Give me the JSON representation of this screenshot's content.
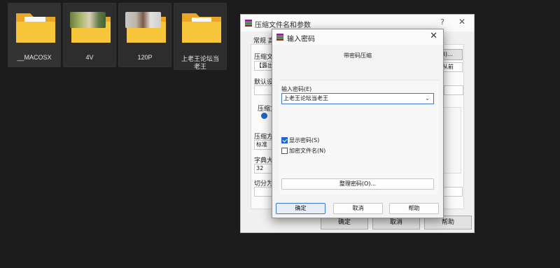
{
  "desktop": {
    "icons": [
      {
        "label": "__MACOSX"
      },
      {
        "label": "4V"
      },
      {
        "label": "120P"
      },
      {
        "label": "上老王论坛当老王"
      }
    ]
  },
  "bg_dialog": {
    "title": "压缩文件名和参数",
    "help_icon": "?",
    "close_icon": "✕",
    "tabs": "常规  高",
    "archive_label": "压缩文件",
    "archive_value": "【露出",
    "browse_button": "(B)...",
    "update_mode_value": "从前",
    "default_label": "默认设置",
    "format_label": "压缩文",
    "method_label": "压缩方式",
    "method_value": "标准",
    "dict_label": "字典大小",
    "dict_value": "32",
    "split_label": "切分为分",
    "ok_button": "确定",
    "cancel_button": "取消",
    "help_button": "帮助"
  },
  "pw_dialog": {
    "title": "输入密码",
    "close_icon": "✕",
    "subtitle": "带密码压缩",
    "input_label": "输入密码(E)",
    "input_value": "上老王论坛当老王",
    "dropdown_icon": "⌄",
    "show_password_label": "显示密码(S)",
    "show_password_checked": true,
    "encrypt_names_label": "加密文件名(N)",
    "encrypt_names_checked": false,
    "organize_button": "整理密码(O)...",
    "ok_button": "确定",
    "cancel_button": "取消",
    "help_button": "帮助"
  }
}
